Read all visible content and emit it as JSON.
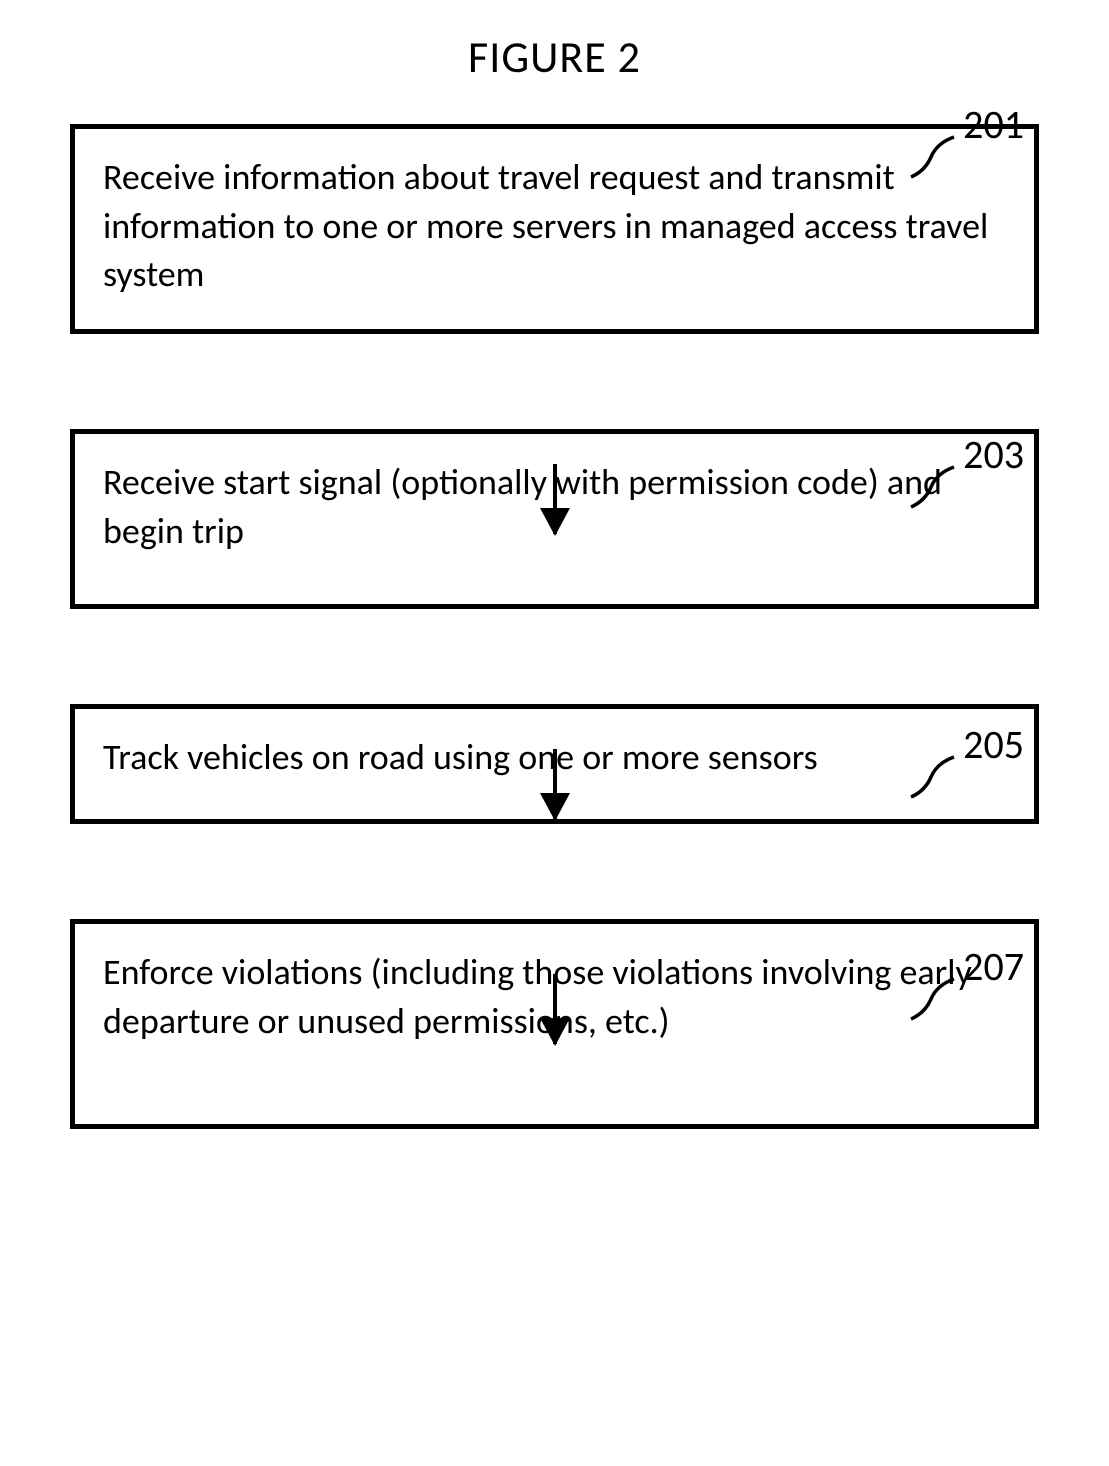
{
  "title": "FIGURE 2",
  "boxes": {
    "box1": "Receive information about travel request and transmit information to one or more servers in managed access travel system",
    "box2": "Receive start signal (optionally with permission code) and begin trip",
    "box3": "Track vehicles on road using one or more sensors",
    "box4": "Enforce violations (including those violations involving early departure or unused permissions, etc.)"
  },
  "labels": {
    "label1": "201",
    "label2": "203",
    "label3": "205",
    "label4": "207"
  }
}
